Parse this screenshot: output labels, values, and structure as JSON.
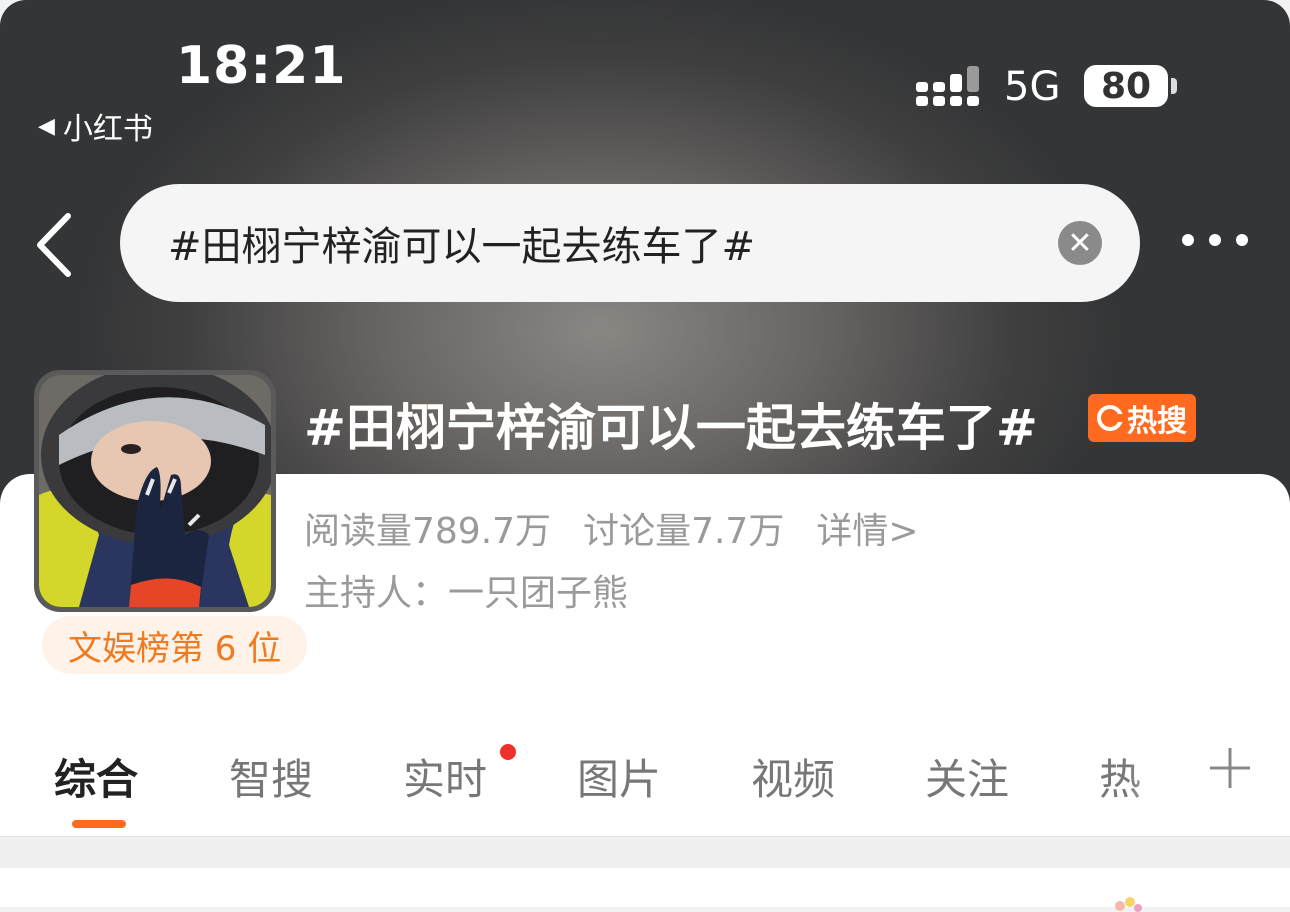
{
  "status_bar": {
    "time": "18:21",
    "back_app": "小红书",
    "network": "5G",
    "battery": "80"
  },
  "search": {
    "query": "#田栩宁梓渝可以一起去练车了#"
  },
  "topic": {
    "title": "#田栩宁梓渝可以一起去练车了#",
    "badge": "热搜",
    "reads": "阅读量789.7万",
    "discussions": "讨论量7.7万",
    "details": "详情>",
    "host": "主持人：一只团子熊",
    "rank": "文娱榜第 6 位"
  },
  "tabs": [
    {
      "label": "综合",
      "active": true
    },
    {
      "label": "智搜"
    },
    {
      "label": "实时",
      "has_dot": true
    },
    {
      "label": "图片"
    },
    {
      "label": "视频"
    },
    {
      "label": "关注"
    },
    {
      "label": "热"
    }
  ],
  "colors": {
    "accent": "#ff6a1f",
    "notification_dot": "#f0302c"
  }
}
